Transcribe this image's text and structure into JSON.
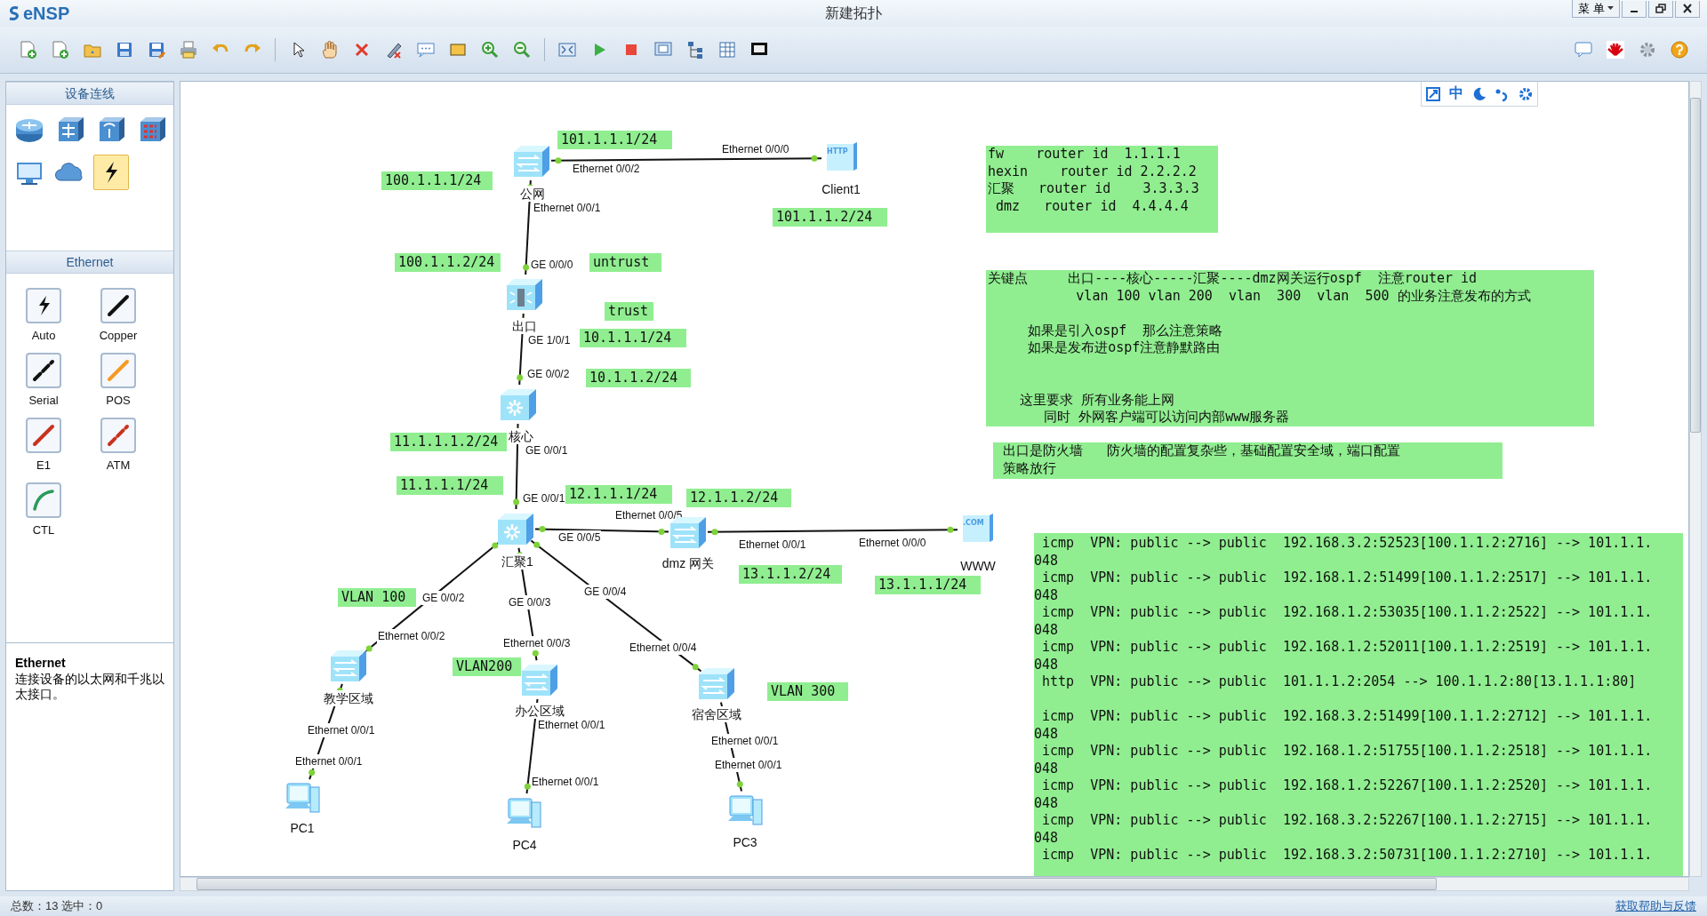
{
  "window": {
    "logo": "eNSP",
    "title": "新建拓扑",
    "menu": "菜 单"
  },
  "left_panel": {
    "devices_header": "设备连线",
    "device_categories": [
      {
        "kind": "router",
        "selected": false
      },
      {
        "kind": "switch",
        "selected": false
      },
      {
        "kind": "wireless",
        "selected": false
      },
      {
        "kind": "firewall",
        "selected": false
      },
      {
        "kind": "terminal",
        "selected": false
      },
      {
        "kind": "cloud",
        "selected": false
      },
      {
        "kind": "cable",
        "selected": true
      }
    ],
    "cables_header": "Ethernet",
    "cables": [
      {
        "label": "Auto",
        "kind": "auto"
      },
      {
        "label": "Copper",
        "kind": "copper"
      },
      {
        "label": "Serial",
        "kind": "serial"
      },
      {
        "label": "POS",
        "kind": "pos"
      },
      {
        "label": "E1",
        "kind": "e1"
      },
      {
        "label": "ATM",
        "kind": "atm"
      },
      {
        "label": "CTL",
        "kind": "ctl"
      }
    ],
    "description": {
      "title": "Ethernet",
      "text": "连接设备的以太网和千兆以太接口。"
    }
  },
  "canvas_toolbar": {
    "language": "中"
  },
  "topology": {
    "devices": [
      {
        "name": "公网",
        "kind": "switch"
      },
      {
        "name": "Client1",
        "kind": "server",
        "badge": "HTTP"
      },
      {
        "name": "出口",
        "kind": "firewall"
      },
      {
        "name": "核心",
        "kind": "core"
      },
      {
        "name": "汇聚1",
        "kind": "core"
      },
      {
        "name": "dmz 网关",
        "kind": "switch"
      },
      {
        "name": "WWW",
        "kind": "server",
        "badge": ".COM"
      },
      {
        "name": "教学区域",
        "kind": "switch"
      },
      {
        "name": "办公区域",
        "kind": "switch"
      },
      {
        "name": "宿舍区域",
        "kind": "switch"
      },
      {
        "name": "PC1",
        "kind": "pc"
      },
      {
        "name": "PC4",
        "kind": "pc"
      },
      {
        "name": "PC3",
        "kind": "pc"
      }
    ],
    "ports": [
      "Ethernet 0/0/0",
      "Ethernet 0/0/2",
      "Ethernet 0/0/1",
      "GE 0/0/0",
      "GE 1/0/1",
      "GE 0/0/2",
      "GE 0/0/1",
      "GE 0/0/1",
      "Ethernet 0/0/5",
      "GE 0/0/5",
      "Ethernet 0/0/1",
      "Ethernet 0/0/0",
      "GE 0/0/2",
      "GE 0/0/3",
      "GE 0/0/4",
      "Ethernet 0/0/2",
      "Ethernet 0/0/3",
      "Ethernet 0/0/4",
      "Ethernet 0/0/1",
      "Ethernet 0/0/1",
      "Ethernet 0/0/1",
      "Ethernet 0/0/1",
      "Ethernet 0/0/1",
      "Ethernet 0/0/1"
    ],
    "labels": [
      "101.1.1.1/24",
      "100.1.1.1/24",
      "101.1.1.2/24",
      "100.1.1.2/24",
      "untrust",
      "trust",
      "10.1.1.1/24",
      "10.1.1.2/24",
      "11.1.1.1.2/24",
      "11.1.1.1/24",
      "12.1.1.1/24",
      "12.1.1.2/24",
      "13.1.1.2/24",
      "13.1.1.1/24",
      "VLAN 100",
      "VLAN200",
      "VLAN 300"
    ],
    "notes": [
      {
        "lines": [
          "fw    router id  1.1.1.1",
          "hexin    router id 2.2.2.2",
          "汇聚   router id    3.3.3.3",
          " dmz   router id  4.4.4.4"
        ]
      },
      {
        "lines": [
          "关键点     出口----核心-----汇聚----dmz网关运行ospf  注意router id",
          "           vlan 100 vlan 200  vlan  300  vlan  500 的业务注意发布的方式",
          "     如果是引入ospf  那么注意策略",
          "     如果是发布进ospf注意静默路由",
          "    这里要求 所有业务能上网",
          "       同时 外网客户端可以访问内部www服务器"
        ]
      },
      {
        "lines": [
          " 出口是防火墙   防火墙的配置复杂些，基础配置安全域，端口配置",
          " 策略放行"
        ]
      }
    ],
    "log": [
      {
        "line": " icmp  VPN: public --> public  192.168.3.2:52523[100.1.1.2:2716] --> 101.1.1.",
        "cont": "048"
      },
      {
        "line": " icmp  VPN: public --> public  192.168.1.2:51499[100.1.1.2:2517] --> 101.1.1.",
        "cont": "048"
      },
      {
        "line": " icmp  VPN: public --> public  192.168.1.2:53035[100.1.1.2:2522] --> 101.1.1.",
        "cont": "048"
      },
      {
        "line": " icmp  VPN: public --> public  192.168.1.2:52011[100.1.1.2:2519] --> 101.1.1.",
        "cont": "048"
      },
      {
        "line": " http  VPN: public --> public  101.1.1.2:2054 --> 100.1.1.2:80[13.1.1.1:80]"
      },
      {
        "line": " icmp  VPN: public --> public  192.168.3.2:51499[100.1.1.2:2712] --> 101.1.1.",
        "cont": "048"
      },
      {
        "line": " icmp  VPN: public --> public  192.168.1.2:51755[100.1.1.2:2518] --> 101.1.1.",
        "cont": "048"
      },
      {
        "line": " icmp  VPN: public --> public  192.168.1.2:52267[100.1.1.2:2520] --> 101.1.1.",
        "cont": "048"
      },
      {
        "line": " icmp  VPN: public --> public  192.168.3.2:52267[100.1.1.2:2715] --> 101.1.1.",
        "cont": "048"
      },
      {
        "line": " icmp  VPN: public --> public  192.168.3.2:50731[100.1.1.2:2710] --> 101.1.1."
      }
    ]
  },
  "status_bar": {
    "count": "总数：13  选中：0",
    "help": "获取帮助与反馈"
  }
}
